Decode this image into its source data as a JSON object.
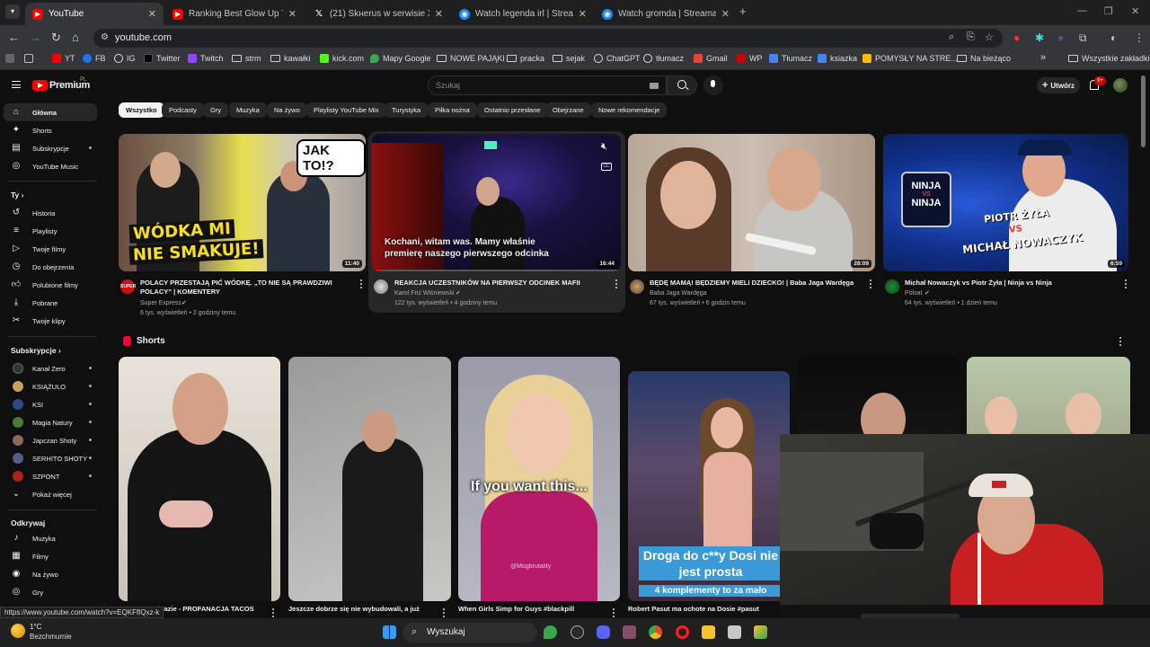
{
  "browser": {
    "tabs": [
      {
        "label": "YouTube",
        "icon": "youtube-icon",
        "active": true
      },
      {
        "label": "Ranking Best Glow Up Transitio",
        "icon": "youtube-icon"
      },
      {
        "label": "(21) Skнerus w serwisie X: „ - V",
        "icon": "x-icon"
      },
      {
        "label": "Watch legenda irl | Streamable",
        "icon": "streamable-icon"
      },
      {
        "label": "Watch gromda | Streamable",
        "icon": "streamable-icon"
      }
    ],
    "new_tab": "+",
    "url": "youtube.com",
    "bookmarks": [
      "YT",
      "FB",
      "IG",
      "Twitter",
      "Twitch",
      "strm",
      "kawałki",
      "kick.com",
      "Mapy Google",
      "NOWE PAJĄKI",
      "pracka",
      "sejak",
      "ChatGPT",
      "tłumacz",
      "Gmail",
      "WP",
      "Tłumacz",
      "ksiazka",
      "POMYSŁY NA STRE...",
      "Na bieżąco"
    ],
    "bookmarks_overflow": "»",
    "all_bookmarks": "Wszystkie zakładki"
  },
  "youtube": {
    "logo_text": "Premium",
    "country": "PL",
    "search_placeholder": "Szukaj",
    "create_label": "Utwórz",
    "notifications_count": "9+"
  },
  "sidebar": {
    "main": [
      {
        "label": "Główna",
        "icon": "home-icon"
      },
      {
        "label": "Shorts",
        "icon": "shorts-icon"
      },
      {
        "label": "Subskrypcje",
        "icon": "subscriptions-icon"
      },
      {
        "label": "YouTube Music",
        "icon": "music-icon"
      }
    ],
    "you_header": "Ty",
    "you": [
      {
        "label": "Historia",
        "icon": "history-icon"
      },
      {
        "label": "Playlisty",
        "icon": "playlist-icon"
      },
      {
        "label": "Twoje filmy",
        "icon": "your-videos-icon"
      },
      {
        "label": "Do obejrzenia",
        "icon": "watch-later-icon"
      },
      {
        "label": "Polubione filmy",
        "icon": "like-icon"
      },
      {
        "label": "Pobrane",
        "icon": "download-icon"
      },
      {
        "label": "Twoje klipy",
        "icon": "clips-icon"
      }
    ],
    "subs_header": "Subskrypcje",
    "subs": [
      {
        "label": "Kanał Zero",
        "color": "#333333"
      },
      {
        "label": "KSIĄŻULO",
        "color": "#c8a060"
      },
      {
        "label": "KSI",
        "color": "#2a4a8a"
      },
      {
        "label": "Magia Natury",
        "color": "#4a7a3a"
      },
      {
        "label": "Japczan Shoty",
        "color": "#8a6a5a"
      },
      {
        "label": "SERHITO SHOTY",
        "color": "#5a5a8a"
      },
      {
        "label": "SZPONT",
        "color": "#aa2222"
      }
    ],
    "show_more": "Pokaż więcej",
    "explore_header": "Odkrywaj",
    "explore": [
      {
        "label": "Muzyka",
        "icon": "music-note-icon"
      },
      {
        "label": "Filmy",
        "icon": "film-icon"
      },
      {
        "label": "Na żywo",
        "icon": "live-icon"
      },
      {
        "label": "Gry",
        "icon": "gaming-icon"
      }
    ]
  },
  "chips": [
    "Wszystko",
    "Podcasty",
    "Gry",
    "Muzyka",
    "Na żywo",
    "Playlisty YouTube Mix",
    "Turystyka",
    "Piłka nożna",
    "Ostatnio przesłane",
    "Obejrzane",
    "Nowe rekomendacje"
  ],
  "videos": [
    {
      "title": "POLACY PRZESTAJĄ PIĆ WÓDKĘ. „TO NIE SĄ PRAWDZIWI POLACY” | KOMENTERY",
      "channel": "Super Express",
      "meta": "6 tys. wyświetleń • 2 godziny temu",
      "duration": "11:40",
      "overlay": [
        "WÓDKA MI",
        "NIE SMAKUJE!"
      ],
      "bubble": "JAK TO!?"
    },
    {
      "title": "REAKCJA UCZESTNIKÓW NA PIERWSZY ODCINEK MAFII",
      "channel": "Karol Friz Wiśniewski",
      "meta": "122 tys. wyświetleń • 4 godziny temu",
      "duration": "16:44",
      "caption": "Kochani, witam was. Mamy właśnie premierę naszego pierwszego odcinka"
    },
    {
      "title": "BĘDĘ MAMĄ! BĘDZIEMY MIELI DZIECKO! | Baba Jaga Wardęga",
      "channel": "Baba Jaga Wardęga",
      "meta": "67 tys. wyświetleń • 6 godzin temu",
      "duration": "28:09"
    },
    {
      "title": "Michał Nowaczyk vs Piotr Żyła | Ninja vs Ninja",
      "channel": "Polsat",
      "meta": "64 tys. wyświetleń • 1 dzień temu",
      "duration": "6:59",
      "overlay": [
        "PIOTR ŻYŁA",
        "VS",
        "MICHAŁ NOWACZYK"
      ],
      "logo": [
        "NINJA",
        "VS",
        "NINJA"
      ]
    }
  ],
  "shorts_header": "Shorts",
  "shorts": [
    {
      "title": "Fazie - PROFANACJA TACOS",
      "prefix": ""
    },
    {
      "title": "Jeszcze dobrze się nie wybudowali, a już",
      "prefix": ""
    },
    {
      "title": "When Girls Simp for Guys #blackpill",
      "caption": "If you want this...",
      "watermark": "@Mogbrutality"
    },
    {
      "title": "Robert Pasut ma ochote na Dosie #pasut",
      "caption1": "Droga do c**y Dosi nie jest prosta",
      "caption2": "4 komplementy to za mało"
    }
  ],
  "status_url": "https://www.youtube.com/watch?v=EQKFfIQxz-k",
  "taskbar": {
    "weather_temp": "1°C",
    "weather_desc": "Bezchmurnie",
    "search_label": "Wyszukaj"
  }
}
